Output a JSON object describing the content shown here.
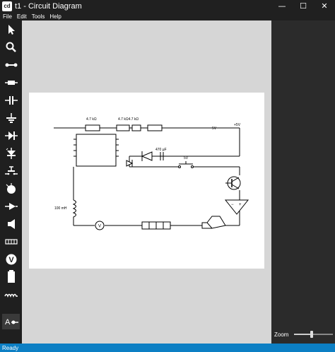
{
  "window": {
    "app_icon": "cd",
    "title": "t1 - Circuit Diagram",
    "minimize_glyph": "—",
    "maximize_glyph": "☐",
    "close_glyph": "✕"
  },
  "menu": [
    "File",
    "Edit",
    "Tools",
    "Help"
  ],
  "toolbox": {
    "tools": [
      {
        "name": "select-pointer-icon",
        "selected": false
      },
      {
        "name": "magnifier-icon",
        "selected": false
      },
      {
        "name": "wire-icon",
        "selected": false
      },
      {
        "name": "resistor-icon",
        "selected": false
      },
      {
        "name": "capacitor-icon",
        "selected": false
      },
      {
        "name": "ground-icon",
        "selected": false
      },
      {
        "name": "diode-icon",
        "selected": false
      },
      {
        "name": "zener-diode-icon",
        "selected": false
      },
      {
        "name": "push-switch-icon",
        "selected": false
      },
      {
        "name": "lamp-icon",
        "selected": false
      },
      {
        "name": "transistor-icon",
        "selected": false
      },
      {
        "name": "speaker-icon",
        "selected": false
      },
      {
        "name": "ic-chip-icon",
        "selected": false
      },
      {
        "name": "voltmeter-icon",
        "selected": false
      },
      {
        "name": "battery-icon",
        "selected": false
      },
      {
        "name": "inductor-icon",
        "selected": false
      },
      {
        "name": "text-label-icon",
        "selected": true
      }
    ],
    "text_tool_glyph": "A"
  },
  "circuit": {
    "resistor_labels": [
      "4.7 kΩ",
      "4.7 kΩ4.7 kΩ"
    ],
    "supply_label_1": "5V",
    "supply_label_2": "+5V",
    "capacitor_label": "470 µF",
    "switch_label": "5V",
    "inductor_label": "100 mH",
    "voltmeter_glyph": "V",
    "opamp_minus": "−",
    "opamp_plus": "+"
  },
  "properties": {
    "zoom_label": "Zoom",
    "zoom_value": 0.45
  },
  "status": {
    "text": "Ready"
  },
  "colors": {
    "titlebar": "#202020",
    "canvas": "#d6d6d6",
    "status_bar": "#0c7fc4"
  }
}
